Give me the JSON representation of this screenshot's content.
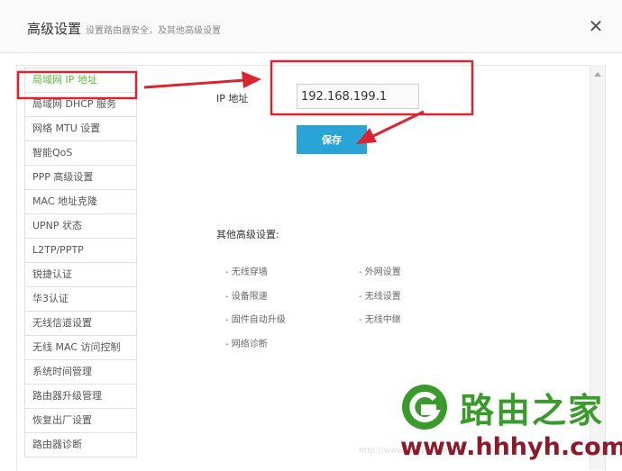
{
  "dialog": {
    "title": "高级设置",
    "subtitle": "设置路由器安全，及其他高级设置",
    "close_glyph": "✕"
  },
  "sidebar": {
    "items": [
      {
        "label": "局域网 IP 地址",
        "active": true
      },
      {
        "label": "局域网 DHCP 服务"
      },
      {
        "label": "网络 MTU 设置"
      },
      {
        "label": "智能QoS"
      },
      {
        "label": "PPP 高级设置"
      },
      {
        "label": "MAC 地址克隆"
      },
      {
        "label": "UPNP 状态"
      },
      {
        "label": "L2TP/PPTP"
      },
      {
        "label": "锐捷认证"
      },
      {
        "label": "华3认证"
      },
      {
        "label": "无线信道设置"
      },
      {
        "label": "无线 MAC 访问控制"
      },
      {
        "label": "系统时间管理"
      },
      {
        "label": "路由器升级管理"
      },
      {
        "label": "恢复出厂设置"
      },
      {
        "label": "路由器诊断"
      }
    ]
  },
  "main": {
    "ip_label": "IP 地址",
    "ip_value": "192.168.199.1",
    "save_label": "保存",
    "other_title": "其他高级设置:",
    "links": {
      "wireless_wall": "- 无线穿墙",
      "wan_settings": "- 外网设置",
      "device_limit": "- 设备限速",
      "wireless_settings": "- 无线设置",
      "firmware_auto": "- 固件自动升级",
      "wireless_relay": "- 无线中继",
      "net_diag": "- 网络诊断"
    }
  },
  "watermark": {
    "name": "路由之家",
    "url": "www.hhhyh.com"
  },
  "colors": {
    "accent_blue": "#2aa3d6",
    "active_green": "#5fb83a",
    "annotation_red": "#d9252f"
  }
}
